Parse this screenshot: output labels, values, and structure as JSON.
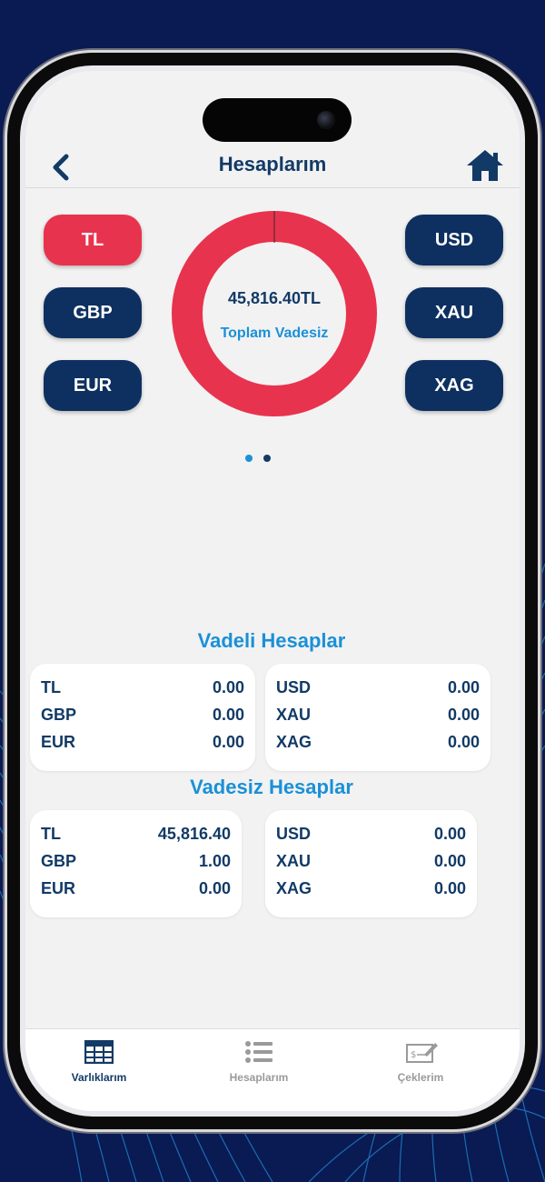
{
  "header": {
    "title": "Hesaplarım"
  },
  "icons": {
    "back": "chevron-left-icon",
    "home": "home-icon"
  },
  "currencies_left": [
    "TL",
    "GBP",
    "EUR"
  ],
  "currencies_right": [
    "USD",
    "XAU",
    "XAG"
  ],
  "selected_currency": "TL",
  "summary": {
    "amount": "45,816.40TL",
    "label": "Toplam Vadesiz"
  },
  "pager": {
    "pages": 2,
    "current": 1
  },
  "vadeli": {
    "title": "Vadeli Hesaplar",
    "left": [
      {
        "code": "TL",
        "value": "0.00"
      },
      {
        "code": "GBP",
        "value": "0.00"
      },
      {
        "code": "EUR",
        "value": "0.00"
      }
    ],
    "right": [
      {
        "code": "USD",
        "value": "0.00"
      },
      {
        "code": "XAU",
        "value": "0.00"
      },
      {
        "code": "XAG",
        "value": "0.00"
      }
    ]
  },
  "vadesiz": {
    "title": "Vadesiz Hesaplar",
    "left": [
      {
        "code": "TL",
        "value": "45,816.40"
      },
      {
        "code": "GBP",
        "value": "1.00"
      },
      {
        "code": "EUR",
        "value": "0.00"
      }
    ],
    "right": [
      {
        "code": "USD",
        "value": "0.00"
      },
      {
        "code": "XAU",
        "value": "0.00"
      },
      {
        "code": "XAG",
        "value": "0.00"
      }
    ]
  },
  "tabs": [
    {
      "label": "Varlıklarım",
      "icon": "table-icon",
      "active": true
    },
    {
      "label": "Hesaplarım",
      "icon": "list-icon",
      "active": false
    },
    {
      "label": "Çeklerim",
      "icon": "cheque-icon",
      "active": false
    }
  ],
  "colors": {
    "navy": "#123a66",
    "accent_red": "#e8334e",
    "accent_blue": "#1a90d8",
    "inactive": "#9a9a9a"
  }
}
